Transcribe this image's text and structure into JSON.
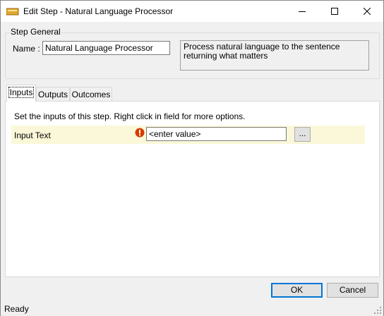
{
  "window": {
    "title": "Edit Step - Natural Language Processor",
    "icon": "folder-step-icon"
  },
  "step_general": {
    "legend": "Step General",
    "name_label": "Name :",
    "name_value": "Natural Language Processor",
    "description": "Process natural language to the sentence returning what matters"
  },
  "tabs": [
    {
      "label": "Inputs",
      "active": true
    },
    {
      "label": "Outputs",
      "active": false
    },
    {
      "label": "Outcomes",
      "active": false
    }
  ],
  "inputs_panel": {
    "help_text": "Set the inputs of this step.  Right click in field for more options.",
    "rows": [
      {
        "label": "Input Text",
        "value": "<enter value>",
        "warning_icon": "error-icon",
        "browse_label": "..."
      }
    ]
  },
  "buttons": {
    "ok": "OK",
    "cancel": "Cancel"
  },
  "status": {
    "text": "Ready"
  },
  "colors": {
    "input_row_bg": "#fbf8d9",
    "ok_focus_border": "#0078d7",
    "error_icon": "#d83b01"
  }
}
